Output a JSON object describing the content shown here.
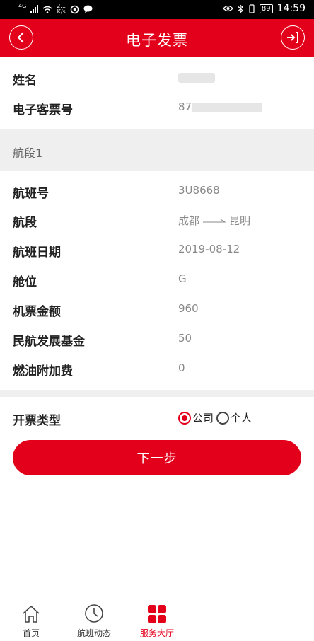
{
  "status_bar": {
    "network": "4G",
    "speed_value": "2.1",
    "speed_unit": "K/s",
    "battery": "89",
    "time": "14:59"
  },
  "header": {
    "title": "电子发票",
    "back_icon": "chevron-left-icon",
    "exit_icon": "exit-icon"
  },
  "passenger": {
    "name_label": "姓名",
    "name_value": "",
    "ticket_label": "电子客票号",
    "ticket_value": "87"
  },
  "segment": {
    "title": "航段1",
    "rows": [
      {
        "label": "航班号",
        "value": "3U8668"
      },
      {
        "label": "航段",
        "from": "成都",
        "to": "昆明"
      },
      {
        "label": "航班日期",
        "value": "2019-08-12"
      },
      {
        "label": "舱位",
        "value": "G"
      },
      {
        "label": "机票金额",
        "value": "960"
      },
      {
        "label": "民航发展基金",
        "value": "50"
      },
      {
        "label": "燃油附加费",
        "value": "0"
      }
    ]
  },
  "invoice_type": {
    "label": "开票类型",
    "options": [
      "公司",
      "个人"
    ],
    "selected": "公司"
  },
  "next_button": "下一步",
  "tabbar": {
    "items": [
      {
        "label": "首页",
        "icon": "home-icon"
      },
      {
        "label": "航班动态",
        "icon": "clock-icon"
      },
      {
        "label": "服务大厅",
        "icon": "grid-icon"
      }
    ],
    "active": "服务大厅"
  },
  "colors": {
    "accent": "#e3001b"
  }
}
